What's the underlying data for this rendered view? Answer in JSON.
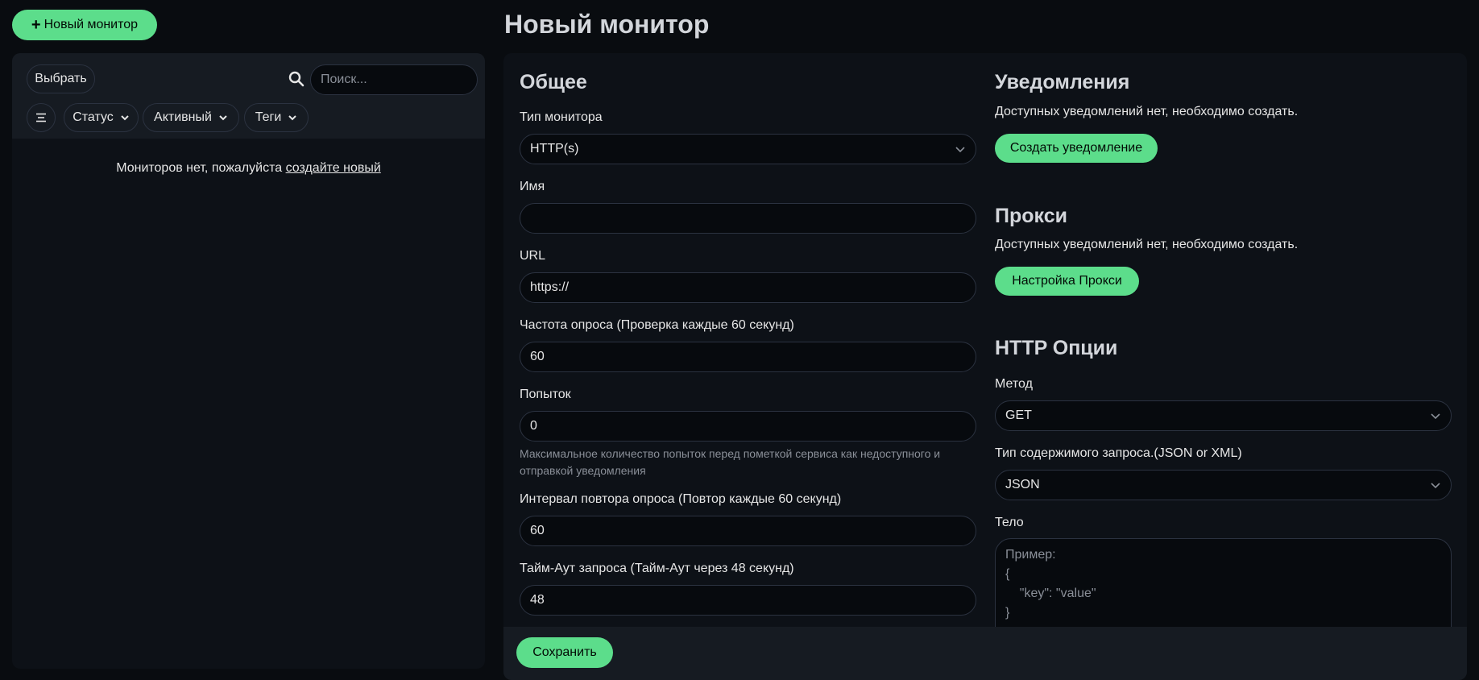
{
  "header": {
    "new_monitor_label": "Новый монитор",
    "page_title": "Новый монитор"
  },
  "sidebar": {
    "select_label": "Выбрать",
    "search_placeholder": "Поиск...",
    "filters": {
      "status": "Статус",
      "active": "Активный",
      "tags": "Теги"
    },
    "empty_text": "Мониторов нет, пожалуйста ",
    "empty_link": "создайте новый"
  },
  "general": {
    "title": "Общее",
    "monitor_type_label": "Тип монитора",
    "monitor_type_value": "HTTP(s)",
    "name_label": "Имя",
    "name_value": "",
    "url_label": "URL",
    "url_value": "https://",
    "interval_label": "Частота опроса (Проверка каждые 60 секунд)",
    "interval_value": "60",
    "retries_label": "Попыток",
    "retries_value": "0",
    "retries_hint_1": "Максимальное количество попыток перед пометкой сервиса как недоступного и",
    "retries_hint_2": "отправкой уведомления",
    "retry_interval_label": "Интервал повтора опроса (Повтор каждые 60 секунд)",
    "retry_interval_value": "60",
    "timeout_label": "Тайм-Аут запроса (Тайм-Аут через 48 секунд)",
    "timeout_value": "48"
  },
  "notifications": {
    "title": "Уведомления",
    "text": "Доступных уведомлений нет, необходимо создать.",
    "button": "Создать уведомление"
  },
  "proxy": {
    "title": "Прокси",
    "text": "Доступных уведомлений нет, необходимо создать.",
    "button": "Настройка Прокси"
  },
  "http_options": {
    "title": "HTTP Опции",
    "method_label": "Метод",
    "method_value": "GET",
    "content_type_label": "Тип содержимого запроса.(JSON or XML)",
    "content_type_value": "JSON",
    "body_label": "Тело",
    "body_placeholder": "Пример:\n{\n    \"key\": \"value\"\n}"
  },
  "footer": {
    "save_label": "Сохранить"
  },
  "colors": {
    "accent": "#5cdd8b",
    "background": "#090c10",
    "panel": "#0d1117",
    "panel_header": "#161b22",
    "input_bg": "#070a0e",
    "border": "#2b3240"
  },
  "icons": [
    "plus-icon",
    "search-icon",
    "filter-list-icon",
    "chevron-down-icon"
  ]
}
